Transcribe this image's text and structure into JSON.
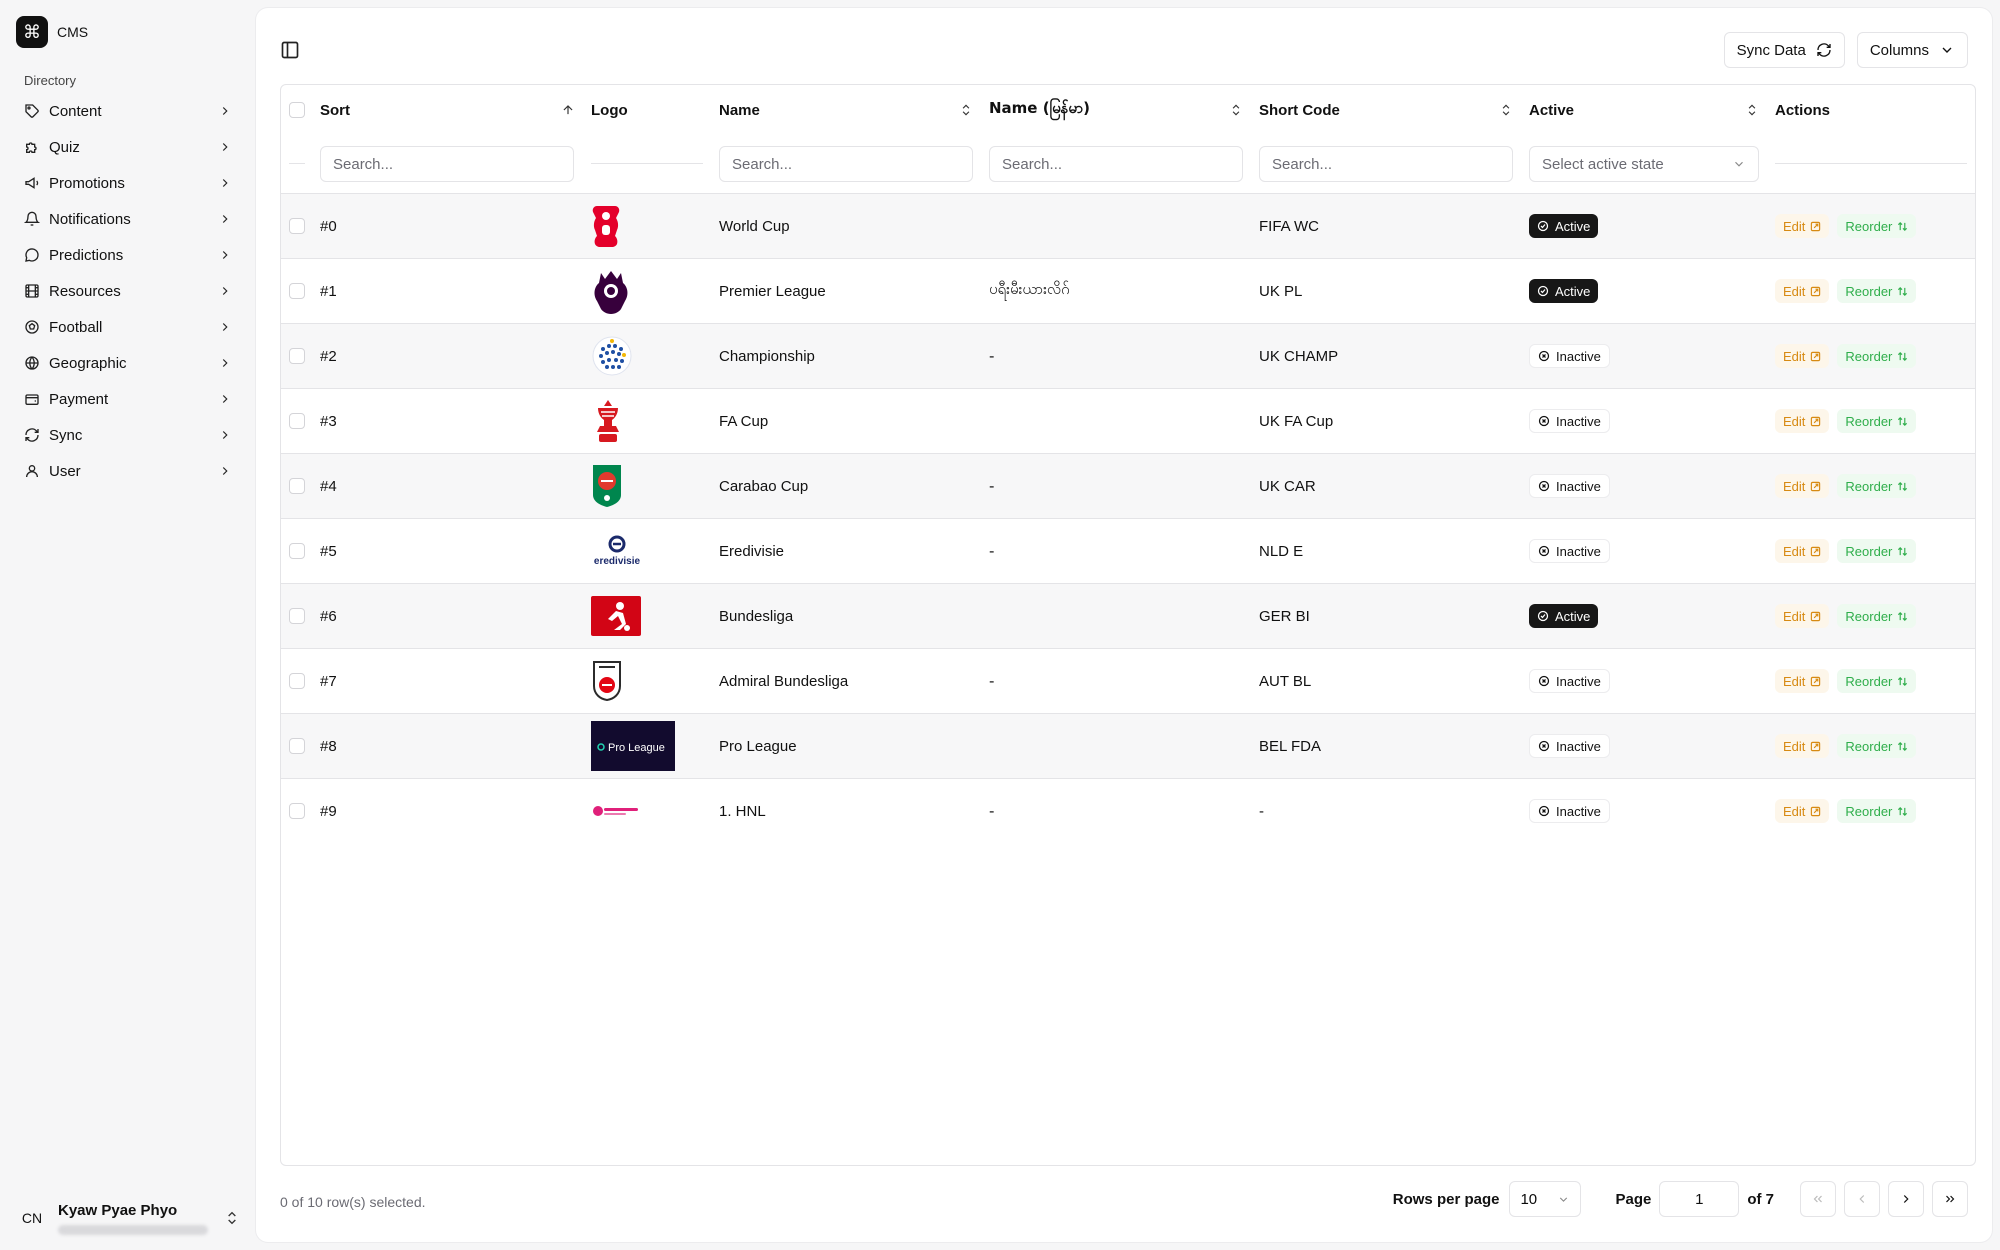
{
  "app": {
    "name": "CMS",
    "logo_glyph": "⌘"
  },
  "sidebar": {
    "group_label": "Directory",
    "items": [
      {
        "label": "Content",
        "icon": "tag-icon"
      },
      {
        "label": "Quiz",
        "icon": "puzzle-icon"
      },
      {
        "label": "Promotions",
        "icon": "megaphone-icon"
      },
      {
        "label": "Notifications",
        "icon": "bell-icon"
      },
      {
        "label": "Predictions",
        "icon": "message-circle-icon"
      },
      {
        "label": "Resources",
        "icon": "film-icon"
      },
      {
        "label": "Football",
        "icon": "football-icon"
      },
      {
        "label": "Geographic",
        "icon": "globe-icon"
      },
      {
        "label": "Payment",
        "icon": "wallet-icon"
      },
      {
        "label": "Sync",
        "icon": "refresh-icon"
      },
      {
        "label": "User",
        "icon": "user-icon"
      }
    ],
    "user": {
      "initials": "CN",
      "name": "Kyaw Pyae Phyo"
    }
  },
  "toolbar": {
    "sync_label": "Sync Data",
    "columns_label": "Columns"
  },
  "table": {
    "headers": {
      "sort": "Sort",
      "logo": "Logo",
      "name": "Name",
      "name_mm": "Name (မြန်မာ)",
      "short_code": "Short Code",
      "active": "Active",
      "actions": "Actions"
    },
    "filters": {
      "search_placeholder": "Search...",
      "active_placeholder": "Select active state"
    },
    "rows": [
      {
        "sort": "#0",
        "logo": "world-cup-logo",
        "name": "World Cup",
        "name_mm": "",
        "short_code": "FIFA WC",
        "active": "Active",
        "is_active": true
      },
      {
        "sort": "#1",
        "logo": "premier-league-logo",
        "name": "Premier League",
        "name_mm": "ပရီးမီးယားလိဂ်",
        "short_code": "UK PL",
        "active": "Active",
        "is_active": true
      },
      {
        "sort": "#2",
        "logo": "championship-logo",
        "name": "Championship",
        "name_mm": "-",
        "short_code": "UK CHAMP",
        "active": "Inactive",
        "is_active": false
      },
      {
        "sort": "#3",
        "logo": "fa-cup-logo",
        "name": "FA Cup",
        "name_mm": "",
        "short_code": "UK FA Cup",
        "active": "Inactive",
        "is_active": false
      },
      {
        "sort": "#4",
        "logo": "carabao-cup-logo",
        "name": "Carabao Cup",
        "name_mm": "-",
        "short_code": "UK CAR",
        "active": "Inactive",
        "is_active": false
      },
      {
        "sort": "#5",
        "logo": "eredivisie-logo",
        "name": "Eredivisie",
        "name_mm": "-",
        "short_code": "NLD E",
        "active": "Inactive",
        "is_active": false
      },
      {
        "sort": "#6",
        "logo": "bundesliga-logo",
        "name": "Bundesliga",
        "name_mm": "",
        "short_code": "GER BI",
        "active": "Active",
        "is_active": true
      },
      {
        "sort": "#7",
        "logo": "admiral-bundesliga-logo",
        "name": "Admiral Bundesliga",
        "name_mm": "-",
        "short_code": "AUT BL",
        "active": "Inactive",
        "is_active": false
      },
      {
        "sort": "#8",
        "logo": "pro-league-logo",
        "name": "Pro League",
        "name_mm": "",
        "short_code": "BEL FDA",
        "active": "Inactive",
        "is_active": false
      },
      {
        "sort": "#9",
        "logo": "hnl-logo",
        "name": "1. HNL",
        "name_mm": "-",
        "short_code": "-",
        "active": "Inactive",
        "is_active": false
      }
    ],
    "row_actions": {
      "edit": "Edit",
      "reorder": "Reorder"
    },
    "logo_texts": {
      "eredivisie": "eredivisie",
      "pro_league": "Pro League"
    }
  },
  "footer": {
    "selection": "0 of 10 row(s) selected.",
    "rows_per_page_label": "Rows per page",
    "rows_per_page_value": "10",
    "page_label": "Page",
    "page_value": "1",
    "page_total": "of 7"
  },
  "colors": {
    "active_badge": "#171717",
    "edit": "#d78a12",
    "reorder": "#2fae4b",
    "bundesliga_red": "#d20515",
    "premier_purple": "#37003c",
    "carabao_green": "#00864e"
  }
}
